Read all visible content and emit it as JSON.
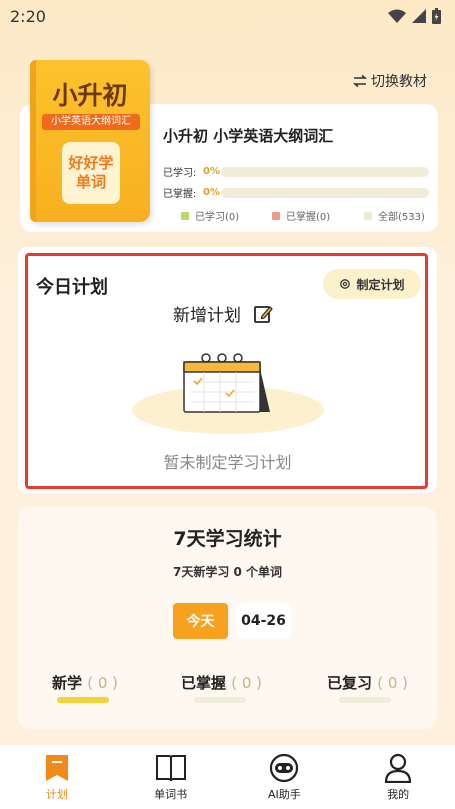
{
  "status": {
    "time": "2:20"
  },
  "header": {
    "switch_label": "切换教材"
  },
  "book": {
    "cover_title": "小升初",
    "cover_subtitle": "小学英语大纲词汇",
    "cover_badge_line1": "好好学",
    "cover_badge_line2": "单词",
    "name": "小升初 小学英语大纲词汇",
    "learned_label": "已学习:",
    "learned_pct": "0%",
    "mastered_label": "已掌握:",
    "mastered_pct": "0%",
    "learned_fraction": 0,
    "mastered_fraction": 0,
    "legend": [
      {
        "label": "已学习(0)",
        "color": "#b8d86a"
      },
      {
        "label": "已掌握(0)",
        "color": "#ee9a86"
      },
      {
        "label": "全部(533)",
        "color": "#e9ead0"
      }
    ]
  },
  "plan": {
    "title": "今日计划",
    "make_plan_label": "制定计划",
    "new_plan_label": "新增计划",
    "empty_text": "暂未制定学习计划"
  },
  "stats": {
    "title": "7天学习统计",
    "subtitle": "7天新学习 0 个单词",
    "today_label": "今天",
    "date_label": "04-26",
    "items": [
      {
        "label": "新学",
        "count": "( 0 )",
        "bar_color": "#f7d13a"
      },
      {
        "label": "已掌握",
        "count": "( 0 )",
        "bar_color": "#eeeedd"
      },
      {
        "label": "已复习",
        "count": "( 0 )",
        "bar_color": "#eeeedd"
      }
    ]
  },
  "tabs": [
    {
      "label": "计划",
      "icon": "bookmark-icon",
      "active": true
    },
    {
      "label": "单词书",
      "icon": "book-icon",
      "active": false
    },
    {
      "label": "AI助手",
      "icon": "robot-icon",
      "active": false
    },
    {
      "label": "我的",
      "icon": "user-icon",
      "active": false
    }
  ],
  "colors": {
    "accent": "#f7a11f",
    "highlight": "#e63b2e"
  }
}
